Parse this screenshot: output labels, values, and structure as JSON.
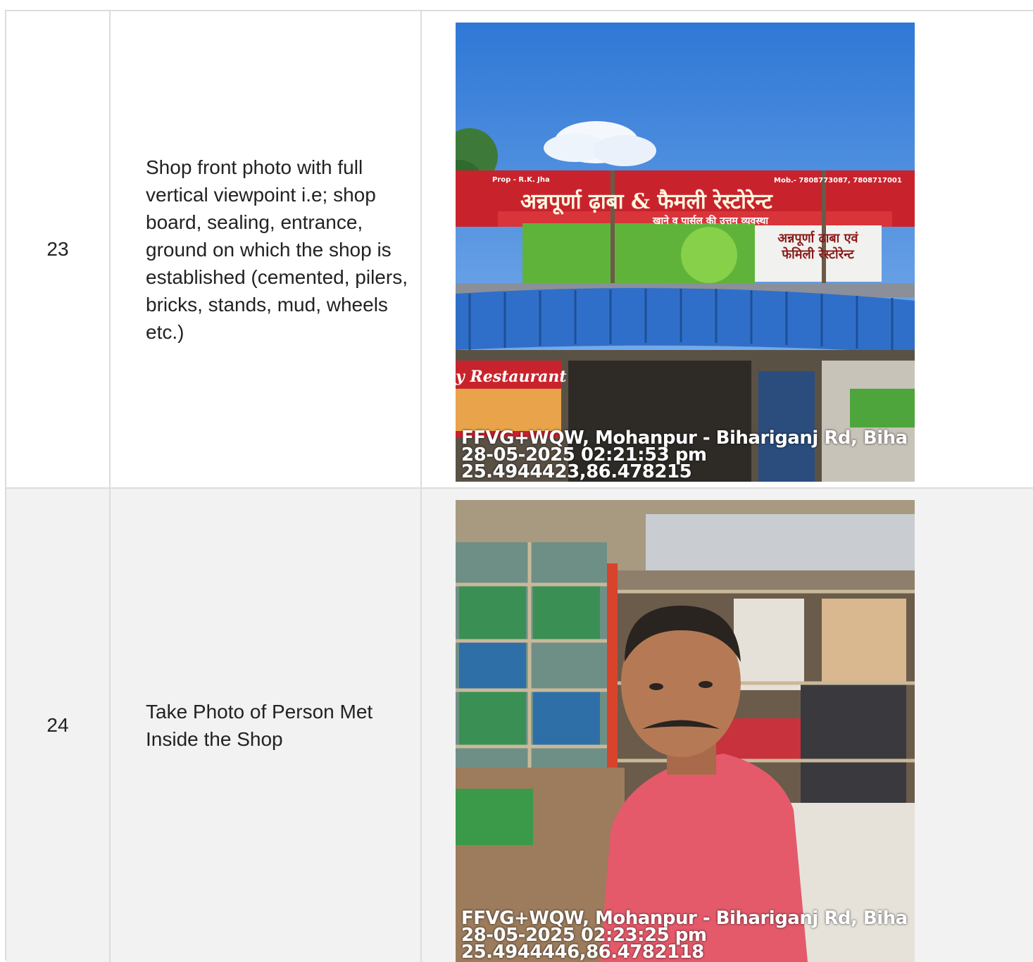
{
  "rows": [
    {
      "number": "23",
      "description": "Shop front photo with full vertical viewpoint i.e; shop board, sealing, entrance, ground on which the shop is established (cemented, pilers, bricks, stands, mud, wheels etc.)",
      "photo": {
        "subject": "restaurant-shop-front",
        "stamp_address": "FFVG+WQW, Mohanpur - Bihariganj Rd, Biha",
        "stamp_datetime": "28-05-2025 02:21:53 pm",
        "stamp_coords": "25.4944423,86.478215",
        "sign_text": "अन्नपूर्णा ढ़ाबा & फैमली रेस्टोरेन्ट",
        "sign_subtext": "खाने व पार्सल की उत्तम व्यवस्था",
        "sign_phone": "Mob.- 7808773087, 7808717001",
        "sign_owner": "Prop - R.K. Jha",
        "side_sign": "अन्नपूर्णा ढाबा एवं फेमिली रेस्टोरेन्ट",
        "restaurant_label": "y Restaurant"
      }
    },
    {
      "number": "24",
      "description": "Take Photo of Person Met Inside the Shop",
      "photo": {
        "subject": "person-inside-shop",
        "stamp_address": "FFVG+WQW, Mohanpur - Bihariganj Rd, Biha",
        "stamp_datetime": "28-05-2025 02:23:25 pm",
        "stamp_coords": "25.4944446,86.4782118"
      }
    }
  ],
  "colors": {
    "border": "#dcdcdc",
    "row_alt_bg": "#f2f2f2",
    "sky": "#3f86db",
    "sign_red": "#c8232c",
    "awning_blue": "#2f6fc9",
    "shirt_pink": "#e45a6a"
  }
}
